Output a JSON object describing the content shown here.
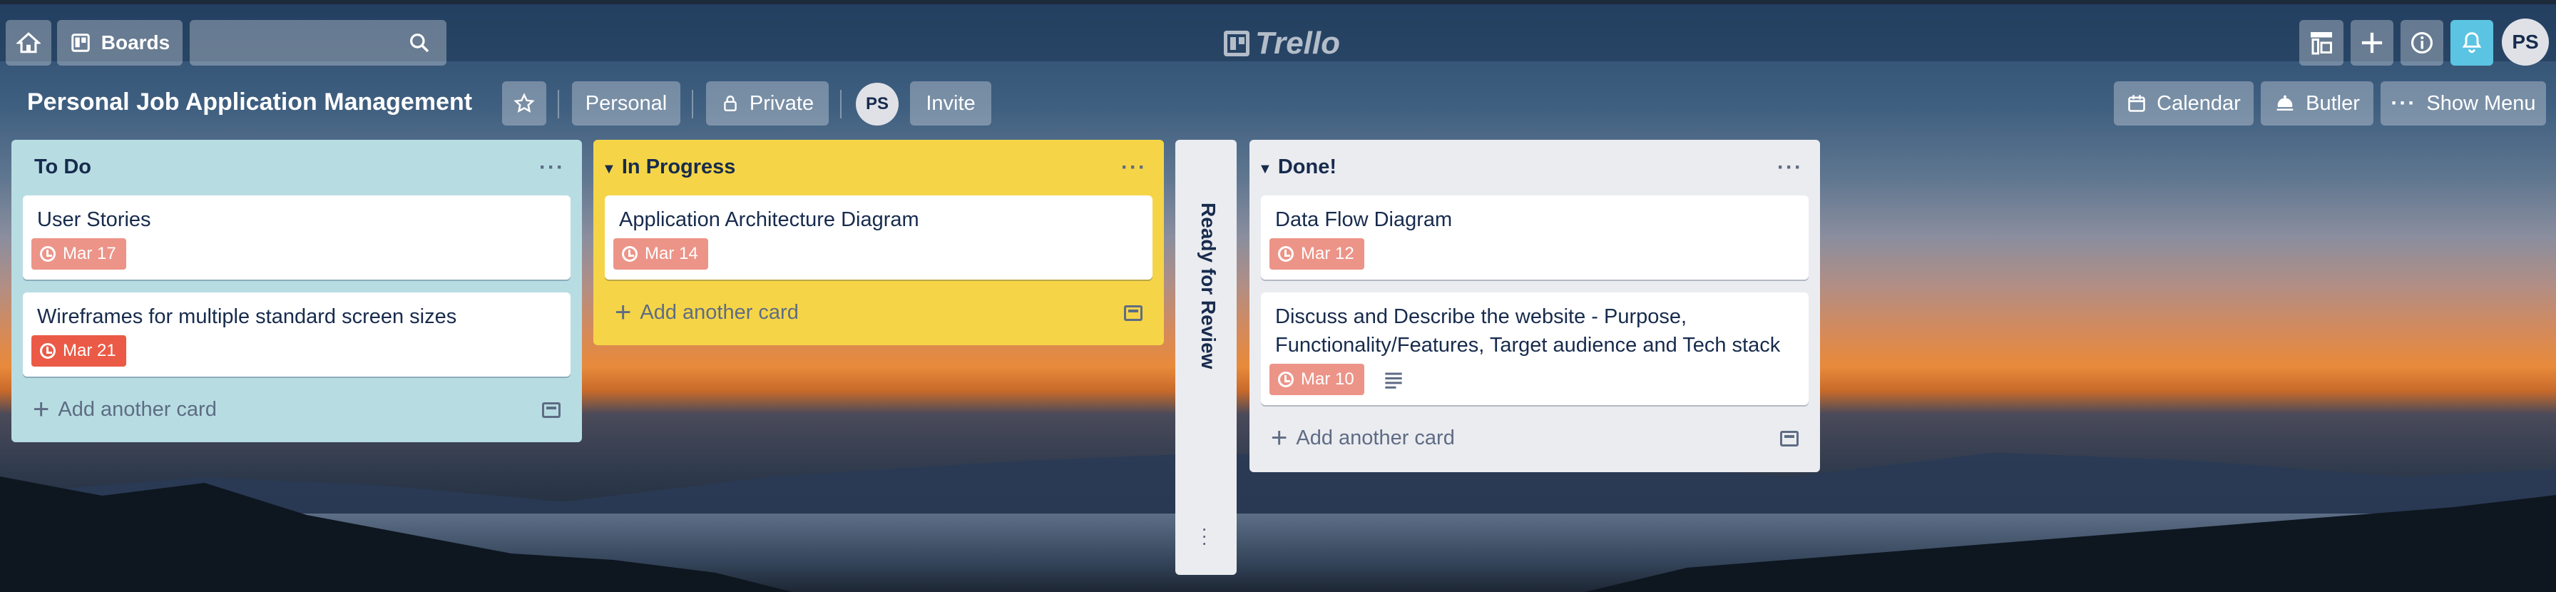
{
  "header": {
    "boards_label": "Boards",
    "logo_text": "Trello",
    "avatar_initials": "PS"
  },
  "board": {
    "title": "Personal Job Application Management",
    "team_label": "Personal",
    "visibility_label": "Private",
    "member_initials": "PS",
    "invite_label": "Invite",
    "calendar_label": "Calendar",
    "butler_label": "Butler",
    "show_menu_label": "Show Menu"
  },
  "lists": [
    {
      "title": "To Do",
      "color": "#b7dde3",
      "cards": [
        {
          "title": "User Stories",
          "due": "Mar 17"
        },
        {
          "title": "Wireframes for multiple standard screen sizes",
          "due": "Mar 21"
        }
      ],
      "add_label": "Add another card"
    },
    {
      "title": "In Progress",
      "color": "#f5d547",
      "cards": [
        {
          "title": "Application Architecture Diagram",
          "due": "Mar 14"
        }
      ],
      "add_label": "Add another card"
    },
    {
      "title": "Ready for Review",
      "collapsed": true
    },
    {
      "title": "Done!",
      "color": "#ebecf0",
      "cards": [
        {
          "title": "Data Flow Diagram",
          "due": "Mar 12"
        },
        {
          "title": "Discuss and Describe the website - Purpose, Functionality/Features, Target audience and Tech stack",
          "due": "Mar 10",
          "has_description": true
        }
      ],
      "add_label": "Add another card"
    }
  ]
}
